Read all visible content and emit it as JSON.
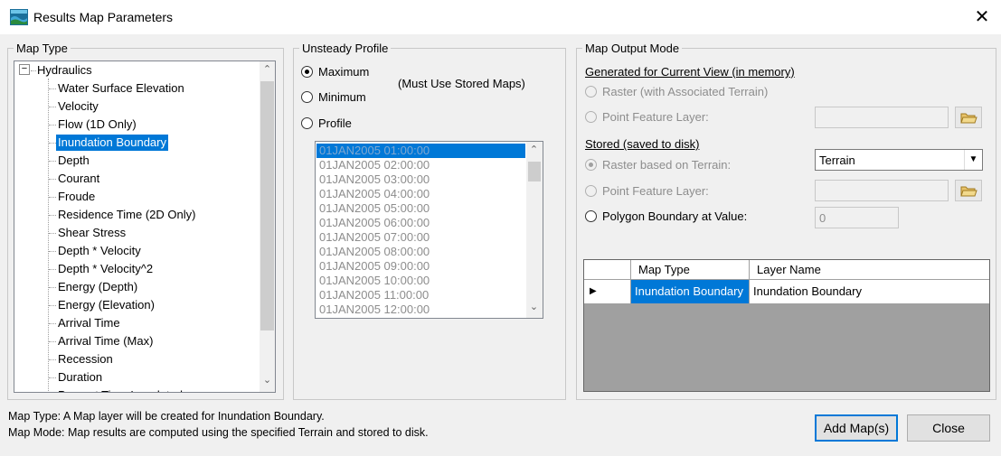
{
  "window": {
    "title": "Results Map Parameters",
    "close_glyph": "✕"
  },
  "map_type": {
    "legend": "Map Type",
    "root_label": "Hydraulics",
    "root_toggle": "⊟",
    "items": [
      "Water Surface Elevation",
      "Velocity",
      "Flow (1D Only)",
      "Inundation Boundary",
      "Depth",
      "Courant",
      "Froude",
      "Residence Time (2D Only)",
      "Shear Stress",
      "Depth * Velocity",
      "Depth * Velocity^2",
      "Energy (Depth)",
      "Energy (Elevation)",
      "Arrival Time",
      "Arrival Time (Max)",
      "Recession",
      "Duration",
      "Percent Time Inundated"
    ],
    "selected": "Inundation Boundary"
  },
  "unsteady_profile": {
    "legend": "Unsteady Profile",
    "options": {
      "maximum": "Maximum",
      "minimum": "Minimum",
      "profile": "Profile"
    },
    "selected": "Maximum",
    "note": "(Must Use Stored Maps)",
    "profiles": [
      "01JAN2005 01:00:00",
      "01JAN2005 02:00:00",
      "01JAN2005 03:00:00",
      "01JAN2005 04:00:00",
      "01JAN2005 05:00:00",
      "01JAN2005 06:00:00",
      "01JAN2005 07:00:00",
      "01JAN2005 08:00:00",
      "01JAN2005 09:00:00",
      "01JAN2005 10:00:00",
      "01JAN2005 11:00:00",
      "01JAN2005 12:00:00"
    ]
  },
  "output_mode": {
    "legend": "Map Output Mode",
    "generated_heading": "Generated for Current View (in memory)",
    "raster_assoc": "Raster (with Associated Terrain)",
    "point_feature_1": "Point Feature Layer:",
    "stored_heading": "Stored (saved to disk)",
    "raster_terrain": "Raster based on Terrain:",
    "terrain_value": "Terrain",
    "point_feature_2": "Point Feature Layer:",
    "polygon_boundary": "Polygon Boundary at Value:",
    "polygon_value": "0",
    "selected": "Raster based on Terrain:"
  },
  "layer_grid": {
    "columns": [
      "Map Type",
      "Layer Name"
    ],
    "row_marker": "▶",
    "rows": [
      {
        "map_type": "Inundation Boundary",
        "layer_name": "Inundation Boundary"
      }
    ]
  },
  "status": {
    "line1": "Map Type: A Map layer will be created for Inundation Boundary.",
    "line2": "Map Mode: Map results are computed using the specified Terrain and stored to disk."
  },
  "buttons": {
    "add_maps": "Add Map(s)",
    "close": "Close"
  },
  "icons": [
    "app-icon",
    "close-icon",
    "folder-open-icon",
    "dropdown-arrow-icon",
    "scroll-up-icon",
    "scroll-down-icon",
    "tree-collapse-icon",
    "row-pointer-icon"
  ]
}
